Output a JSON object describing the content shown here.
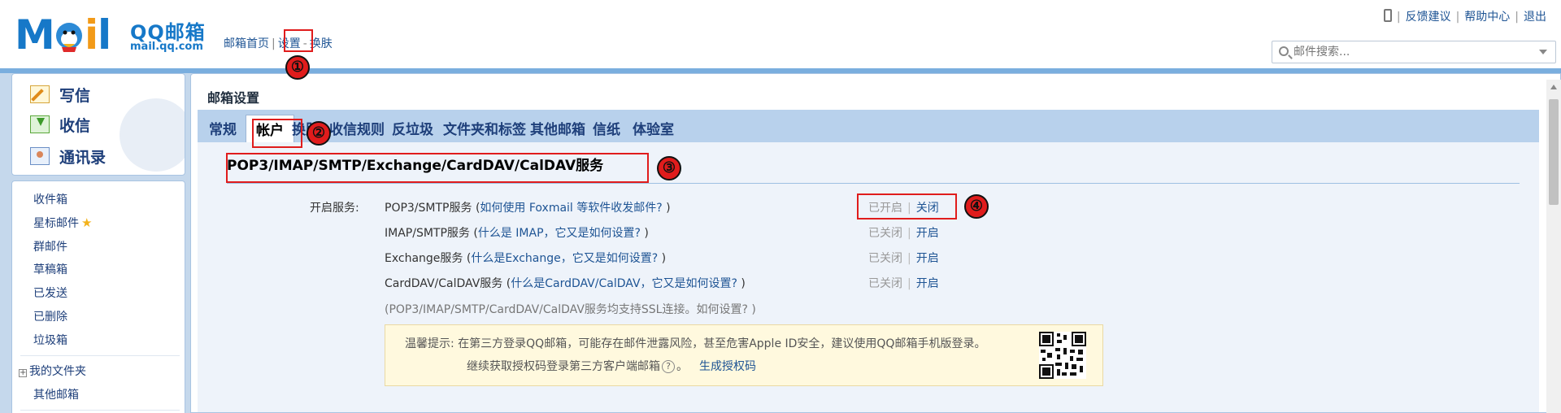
{
  "logo": {
    "brand_title": "QQ邮箱",
    "domain": "mail.qq.com"
  },
  "topnav": {
    "home": "邮箱首页",
    "separator": "|",
    "settings": "设置",
    "dash": "-",
    "skin": "换肤"
  },
  "toplinks": {
    "feedback": "反馈建议",
    "help": "帮助中心",
    "logout": "退出",
    "separator": "|"
  },
  "search": {
    "placeholder": "邮件搜索..."
  },
  "sidebar": {
    "compose": "写信",
    "receive": "收信",
    "contacts": "通讯录",
    "folders": [
      "收件箱",
      "星标邮件",
      "群邮件",
      "草稿箱",
      "已发送",
      "已删除",
      "垃圾箱"
    ],
    "my_folders": "我的文件夹",
    "my_folders_toggle": "+",
    "other_mailboxes": "其他邮箱"
  },
  "main": {
    "title": "邮箱设置",
    "tabs": [
      "常规",
      "帐户",
      "换肤",
      "收信规则",
      "反垃圾",
      "文件夹和标签",
      "其他邮箱",
      "信纸",
      "体验室"
    ],
    "active_tab": "帐户",
    "services_title": "POP3/IMAP/SMTP/Exchange/CardDAV/CalDAV服务",
    "enable_label": "开启服务:",
    "services": [
      {
        "name": "POP3/SMTP服务 (",
        "help": "如何使用 Foxmail 等软件收发邮件?",
        "close": " )",
        "state": "已开启",
        "action": "关闭"
      },
      {
        "name": "IMAP/SMTP服务 (",
        "help": "什么是 IMAP，它又是如何设置?",
        "close": " )",
        "state": "已关闭",
        "action": "开启"
      },
      {
        "name": "Exchange服务 (",
        "help": "什么是Exchange，它又是如何设置?",
        "close": " )",
        "state": "已关闭",
        "action": "开启"
      },
      {
        "name": "CardDAV/CalDAV服务 (",
        "help": "什么是CardDAV/CalDAV，它又是如何设置?",
        "close": " )",
        "state": "已关闭",
        "action": "开启"
      }
    ],
    "state_separator": "|",
    "ssl_note": "(POP3/IMAP/SMTP/CardDAV/CalDAV服务均支持SSL连接。如何设置? )",
    "tip": {
      "line1": "温馨提示:  在第三方登录QQ邮箱，可能存在邮件泄露风险，甚至危害Apple ID安全，建议使用QQ邮箱手机版登录。",
      "line2": "继续获取授权码登录第三方客户端邮箱",
      "help_glyph": "?",
      "line2_end": "。",
      "link": "生成授权码"
    }
  },
  "annotations": [
    "①",
    "②",
    "③",
    "④"
  ],
  "colors": {
    "accent": "#1e5494",
    "frame": "#c5d8ec",
    "tab_bar": "#b8d1ec",
    "annotation_red": "#e01c1c",
    "tip_bg": "#fff9de"
  }
}
